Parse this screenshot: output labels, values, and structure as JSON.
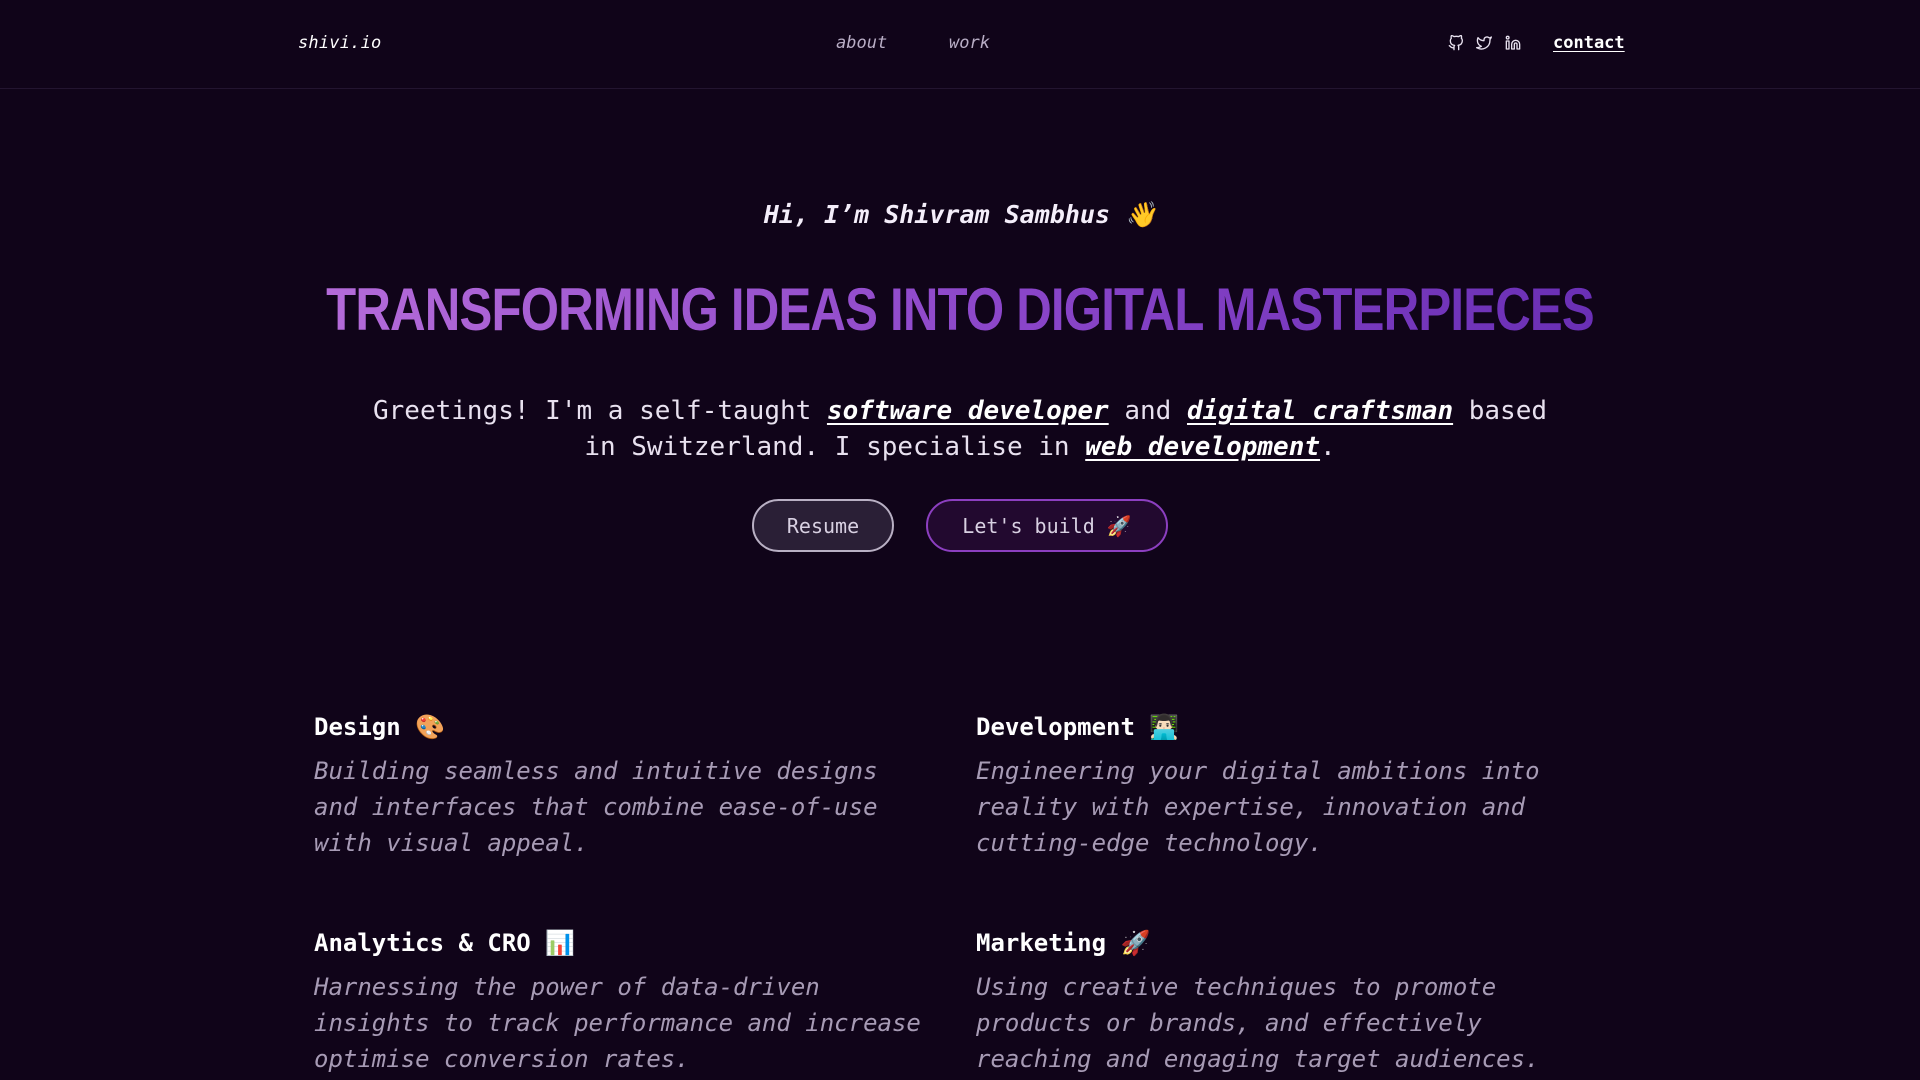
{
  "header": {
    "logo": "shivi.io",
    "nav": {
      "about": "about",
      "work": "work"
    },
    "social_icons": [
      "github-icon",
      "twitter-icon",
      "linkedin-icon"
    ],
    "contact": "contact"
  },
  "hero": {
    "greeting": "Hi, I’m Shivram Sambhus 👋",
    "headline": "TRANSFORMING IDEAS INTO DIGITAL MASTERPIECES",
    "intro": {
      "part1": "Greetings! I'm a self-taught ",
      "link1": "software developer",
      "part2": " and ",
      "link2": "digital craftsman",
      "part3": " based in Switzerland. I specialise in ",
      "link3": "web development",
      "part4": "."
    },
    "buttons": {
      "resume": "Resume",
      "build": "Let's build 🚀"
    }
  },
  "services": {
    "design": {
      "title": "Design 🎨",
      "description": "Building seamless and intuitive designs and interfaces that combine ease-of-use with visual appeal."
    },
    "development": {
      "title": "Development 👨🏻‍💻",
      "description": "Engineering your digital ambitions into reality with expertise, innovation and cutting-edge technology."
    },
    "analytics": {
      "title": "Analytics & CRO 📊",
      "description": "Harnessing the power of data-driven insights to track performance and increase optimise conversion rates."
    },
    "marketing": {
      "title": "Marketing 🚀",
      "description": "Using creative techniques to promote products or brands, and effectively reaching and engaging target audiences."
    }
  },
  "colors": {
    "background": "#100419",
    "accent_start": "#b46bd9",
    "accent_end": "#6a2fb5",
    "button_border_accent": "#8c3fc0"
  }
}
